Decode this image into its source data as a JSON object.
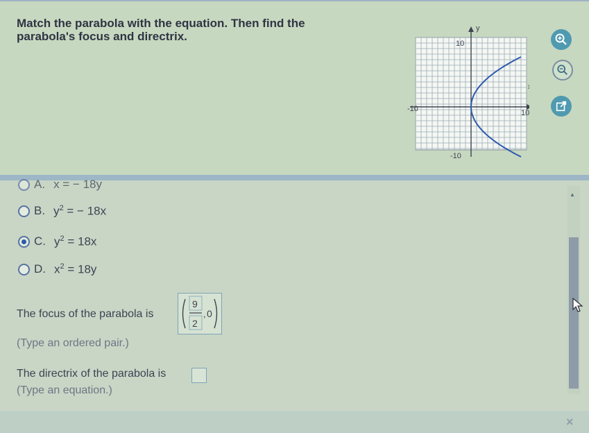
{
  "question": {
    "line1": "Match the parabola with the equation. Then find the",
    "line2": "parabola's focus and directrix."
  },
  "graph": {
    "y_axis_label": "y",
    "x_axis_label": "x",
    "tick_top": "10",
    "tick_bottom": "-10",
    "tick_left": "-10",
    "tick_right": "10",
    "curve_color": "#2e5ab0"
  },
  "tools": [
    "zoom-in-icon",
    "zoom-out-icon",
    "external-link-icon"
  ],
  "options": {
    "a": {
      "letter": "A.",
      "text": "x = − 18y"
    },
    "b": {
      "letter": "B.",
      "base": "y",
      "exp": "2",
      "rest": " = − 18x"
    },
    "c": {
      "letter": "C.",
      "base": "y",
      "exp": "2",
      "rest": " = 18x"
    },
    "d": {
      "letter": "D.",
      "base": "x",
      "exp": "2",
      "rest": " = 18y"
    }
  },
  "selected_option": "C",
  "focus": {
    "label": "The focus of the parabola is",
    "numerator": "9",
    "denominator": "2",
    "y_value": "0",
    "hint": "(Type an ordered pair.)"
  },
  "directrix": {
    "label": "The directrix of the parabola is",
    "value": "",
    "hint": "(Type an equation.)"
  },
  "footer": {
    "close_symbol": "×"
  }
}
